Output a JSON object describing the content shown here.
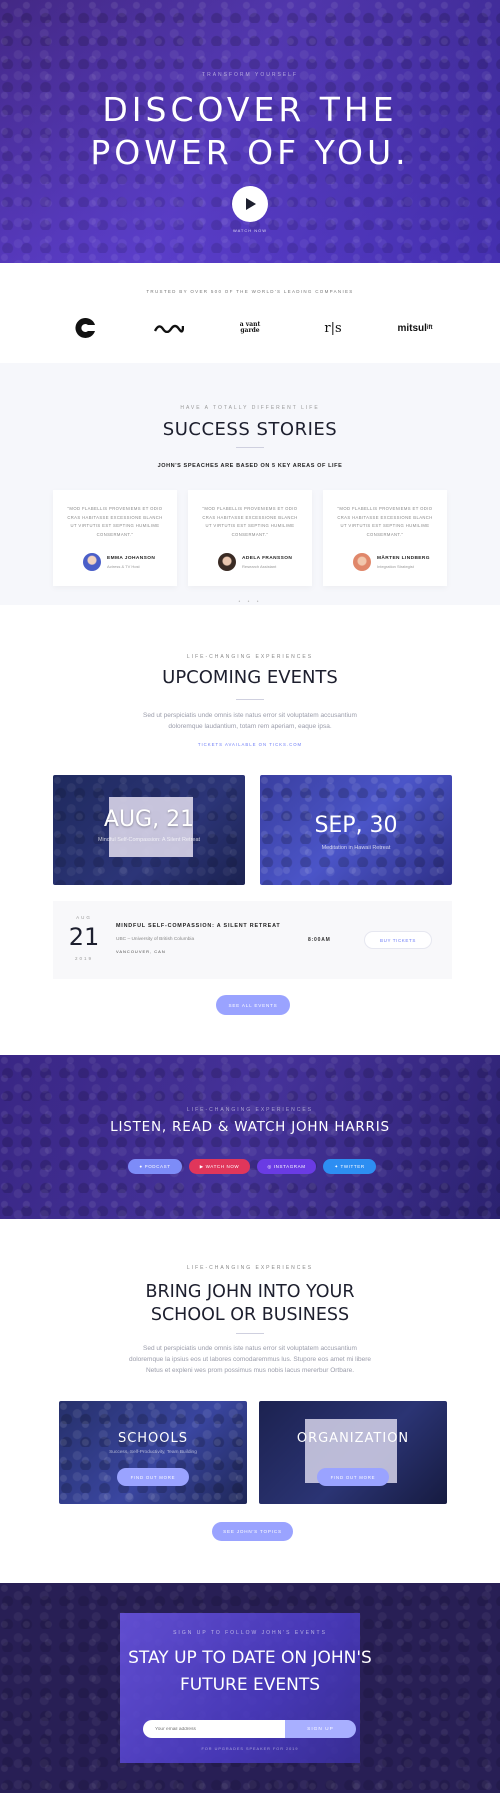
{
  "hero": {
    "eyebrow": "TRANSFORM YOURSELF",
    "title_line1": "DISCOVER THE",
    "title_line2": "POWER OF YOU.",
    "play_icon": "play-icon",
    "watch_label": "WATCH NOW"
  },
  "logos": {
    "trusted": "TRUSTED BY OVER 500 OF THE WORLD'S LEADING COMPANIES",
    "items": [
      "e",
      "〰",
      "vant garde",
      "r|s",
      "mitsu lift"
    ]
  },
  "success": {
    "eyebrow": "HAVE A TOTALLY DIFFERENT LIFE",
    "title": "SUCCESS STORIES",
    "subtitle": "JOHN'S SPEACHES ARE BASED ON 5 KEY AREAS OF LIFE",
    "cards": [
      {
        "quote": "\"MOD FLABELLIS PROVENIEMS ET ODIO CRAS HABITASSE EXCESSIONE BLANCH UT VIRTUTIS EST SEPTING HUMILIME CONSERMANT.\"",
        "name": "EMMA JOHANSON",
        "role": "Actress & TV Host",
        "color": "#5a6fd8"
      },
      {
        "quote": "\"MOD FLABELLIS PROVENIEMS ET ODIO CRAS HABITASSE EXCESSIONE BLANCH UT VIRTUTIS EST SEPTING HUMILIME CONSERMANT.\"",
        "name": "ADELA FRANSSON",
        "role": "Research Assistant",
        "color": "#3a2b24"
      },
      {
        "quote": "\"MOD FLABELLIS PROVENIEMS ET ODIO CRAS HABITASSE EXCESSIONE BLANCH UT VIRTUTIS EST SEPTING HUMILIME CONSERMANT.\"",
        "name": "MÅRTEN LINDBERG",
        "role": "Integration Strategist",
        "color": "#e0876a"
      }
    ],
    "dots": "• • •"
  },
  "events": {
    "eyebrow": "LIFE-CHANGING EXPERIENCES",
    "title": "UPCOMING EVENTS",
    "desc_line1": "Sed ut perspiciatis unde omnis iste natus error sit voluptatem accusantium",
    "desc_line2": "doloremque laudantium, totam rem aperiam, eaque ipsa.",
    "tickets_note": "TICKETS AVAILABLE ON TICKS.COM",
    "cards": [
      {
        "date": "AUG, 21",
        "caption": "Mindful Self-Compassion: A Silent Retreat"
      },
      {
        "date": "SEP, 30",
        "caption": "Meditation in Hawaii Retreat"
      }
    ],
    "row": {
      "month": "AUG",
      "day": "21",
      "year": "2019",
      "title": "MINDFUL SELF-COMPASSION: A SILENT RETREAT",
      "venue": "UBC – University of British Columbia",
      "city": "VANCOUVER, CAN",
      "time": "8:00AM",
      "buy_label": "BUY TICKETS"
    },
    "see_all": "SEE ALL EVENTS"
  },
  "listen": {
    "eyebrow": "LIFE-CHANGING EXPERIENCES",
    "title": "LISTEN, READ & WATCH JOHN HARRIS",
    "buttons": [
      {
        "label": "PODCAST",
        "icon": "podcast-icon",
        "color": "#7d8cf8"
      },
      {
        "label": "WATCH NOW",
        "icon": "youtube-icon",
        "color": "#e0365b"
      },
      {
        "label": "INSTAGRAM",
        "icon": "instagram-icon",
        "color": "#6a3be4"
      },
      {
        "label": "TWITTER",
        "icon": "twitter-icon",
        "color": "#2d8ef2"
      }
    ]
  },
  "school": {
    "eyebrow": "LIFE-CHANGING EXPERIENCES",
    "title_line1": "BRING JOHN INTO YOUR",
    "title_line2": "SCHOOL OR BUSINESS",
    "desc_line1": "Sed ut perspiciatis unde omnis iste natus error sit voluptatem accusantium",
    "desc_line2": "doloremque la ipsius eos ut labores comodaremmus lus. Stupore eos amet mi libere",
    "desc_line3": "Netus et expleni wes prom possimus mus nobis lacus mererbur Ortbare.",
    "cards": [
      {
        "title": "SCHOOLS",
        "sub": "Success, Self-Productivity, Team Building",
        "button": "FIND OUT MORE"
      },
      {
        "title": "ORGANIZATION",
        "sub": "",
        "button": "FIND OUT MORE"
      }
    ],
    "see_topics": "SEE JOHN'S TOPICS"
  },
  "newsletter": {
    "eyebrow": "SIGN UP TO FOLLOW JOHN'S EVENTS",
    "title_line1": "STAY UP TO DATE ON JOHN'S",
    "title_line2": "FUTURE EVENTS",
    "email_placeholder": "Your email address",
    "signup_label": "SIGN UP",
    "fine_print": "FOR UPGRADES SPEAKER FOR 2019"
  },
  "colors": {
    "accent": "#9aa3ff",
    "link": "#6d7cf6",
    "hero": "#5b3fc0",
    "dark": "#1d1f2e"
  }
}
